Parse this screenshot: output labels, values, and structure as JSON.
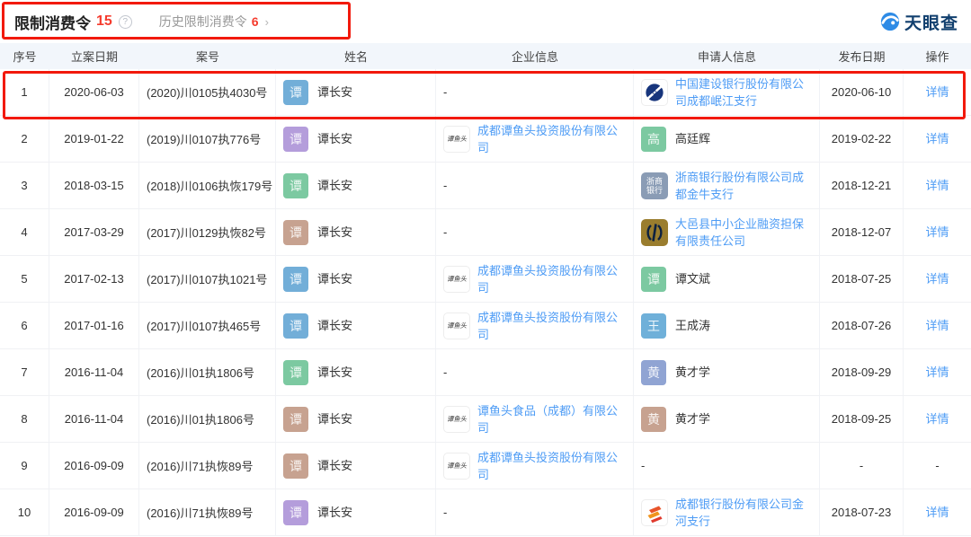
{
  "page": {
    "title": "限制消费令",
    "title_count": "15",
    "help_mark": "?",
    "history_label": "历史限制消费令",
    "history_count": "6",
    "history_arrow": "›",
    "brand": "天眼查"
  },
  "colors": {
    "annotation_red": "#f2190c",
    "link_blue": "#4e9cf5",
    "count_red": "#f53b2d",
    "brand_blue": "#2e8be6",
    "brand_text_blue": "#113f6e",
    "header_bg": "#f2f6fb"
  },
  "logo_art": {
    "tanyutou_text": "谭鱼头",
    "zheshang_lines": [
      "浙商",
      "银行"
    ]
  },
  "table": {
    "headers": [
      "序号",
      "立案日期",
      "案号",
      "姓名",
      "企业信息",
      "申请人信息",
      "发布日期",
      "操作"
    ],
    "rows": [
      {
        "no": "1",
        "date": "2020-06-03",
        "case": "(2020)川0105执4030号",
        "person": {
          "char": "谭",
          "color": "#72aed8",
          "name": "谭长安"
        },
        "company": {
          "dash": "-"
        },
        "applicant": {
          "type": "company",
          "logo": "ccb",
          "name": "中国建设银行股份有限公司成都岷江支行"
        },
        "publish": "2020-06-10",
        "action": {
          "label": "详情",
          "link": true
        },
        "highlighted": true
      },
      {
        "no": "2",
        "date": "2019-01-22",
        "case": "(2019)川0107执776号",
        "person": {
          "char": "谭",
          "color": "#b49ddb",
          "name": "谭长安"
        },
        "company": {
          "logo": "tanyutou",
          "name": "成都谭鱼头投资股份有限公司"
        },
        "applicant": {
          "type": "person",
          "char": "高",
          "color": "#7cc9a1",
          "name": "高廷辉"
        },
        "publish": "2019-02-22",
        "action": {
          "label": "详情",
          "link": true
        },
        "highlighted": false
      },
      {
        "no": "3",
        "date": "2018-03-15",
        "case": "(2018)川0106执恢179号",
        "person": {
          "char": "谭",
          "color": "#7cc9a1",
          "name": "谭长安"
        },
        "company": {
          "dash": "-"
        },
        "applicant": {
          "type": "company",
          "logo": "zheshang",
          "name": "浙商银行股份有限公司成都金牛支行"
        },
        "publish": "2018-12-21",
        "action": {
          "label": "详情",
          "link": true
        },
        "highlighted": false
      },
      {
        "no": "4",
        "date": "2017-03-29",
        "case": "(2017)川0129执恢82号",
        "person": {
          "char": "谭",
          "color": "#c7a290",
          "name": "谭长安"
        },
        "company": {
          "dash": "-"
        },
        "applicant": {
          "type": "company",
          "logo": "dayi",
          "name": "大邑县中小企业融资担保有限责任公司"
        },
        "publish": "2018-12-07",
        "action": {
          "label": "详情",
          "link": true
        },
        "highlighted": false
      },
      {
        "no": "5",
        "date": "2017-02-13",
        "case": "(2017)川0107执1021号",
        "person": {
          "char": "谭",
          "color": "#72aed8",
          "name": "谭长安"
        },
        "company": {
          "logo": "tanyutou",
          "name": "成都谭鱼头投资股份有限公司"
        },
        "applicant": {
          "type": "person",
          "char": "谭",
          "color": "#7cc9a1",
          "name": "谭文斌"
        },
        "publish": "2018-07-25",
        "action": {
          "label": "详情",
          "link": true
        },
        "highlighted": false
      },
      {
        "no": "6",
        "date": "2017-01-16",
        "case": "(2017)川0107执465号",
        "person": {
          "char": "谭",
          "color": "#72aed8",
          "name": "谭长安"
        },
        "company": {
          "logo": "tanyutou",
          "name": "成都谭鱼头投资股份有限公司"
        },
        "applicant": {
          "type": "person",
          "char": "王",
          "color": "#6fb0d9",
          "name": "王成涛"
        },
        "publish": "2018-07-26",
        "action": {
          "label": "详情",
          "link": true
        },
        "highlighted": false
      },
      {
        "no": "7",
        "date": "2016-11-04",
        "case": "(2016)川01执1806号",
        "person": {
          "char": "谭",
          "color": "#7cc9a1",
          "name": "谭长安"
        },
        "company": {
          "dash": "-"
        },
        "applicant": {
          "type": "person",
          "char": "黄",
          "color": "#90a4d3",
          "name": "黄才学"
        },
        "publish": "2018-09-29",
        "action": {
          "label": "详情",
          "link": true
        },
        "highlighted": false
      },
      {
        "no": "8",
        "date": "2016-11-04",
        "case": "(2016)川01执1806号",
        "person": {
          "char": "谭",
          "color": "#c7a290",
          "name": "谭长安"
        },
        "company": {
          "logo": "tanyutou",
          "name": "谭鱼头食品（成都）有限公司"
        },
        "applicant": {
          "type": "person",
          "char": "黄",
          "color": "#c7a290",
          "name": "黄才学"
        },
        "publish": "2018-09-25",
        "action": {
          "label": "详情",
          "link": true
        },
        "highlighted": false
      },
      {
        "no": "9",
        "date": "2016-09-09",
        "case": "(2016)川71执恢89号",
        "person": {
          "char": "谭",
          "color": "#c7a290",
          "name": "谭长安"
        },
        "company": {
          "logo": "tanyutou",
          "name": "成都谭鱼头投资股份有限公司"
        },
        "applicant": {
          "type": "dash",
          "dash": "-"
        },
        "publish": "-",
        "action": {
          "label": "-",
          "link": false
        },
        "highlighted": false
      },
      {
        "no": "10",
        "date": "2016-09-09",
        "case": "(2016)川71执恢89号",
        "person": {
          "char": "谭",
          "color": "#b49ddb",
          "name": "谭长安"
        },
        "company": {
          "dash": "-"
        },
        "applicant": {
          "type": "company",
          "logo": "chengdu-bank",
          "name": "成都银行股份有限公司金河支行"
        },
        "publish": "2018-07-23",
        "action": {
          "label": "详情",
          "link": true
        },
        "highlighted": false
      }
    ]
  }
}
